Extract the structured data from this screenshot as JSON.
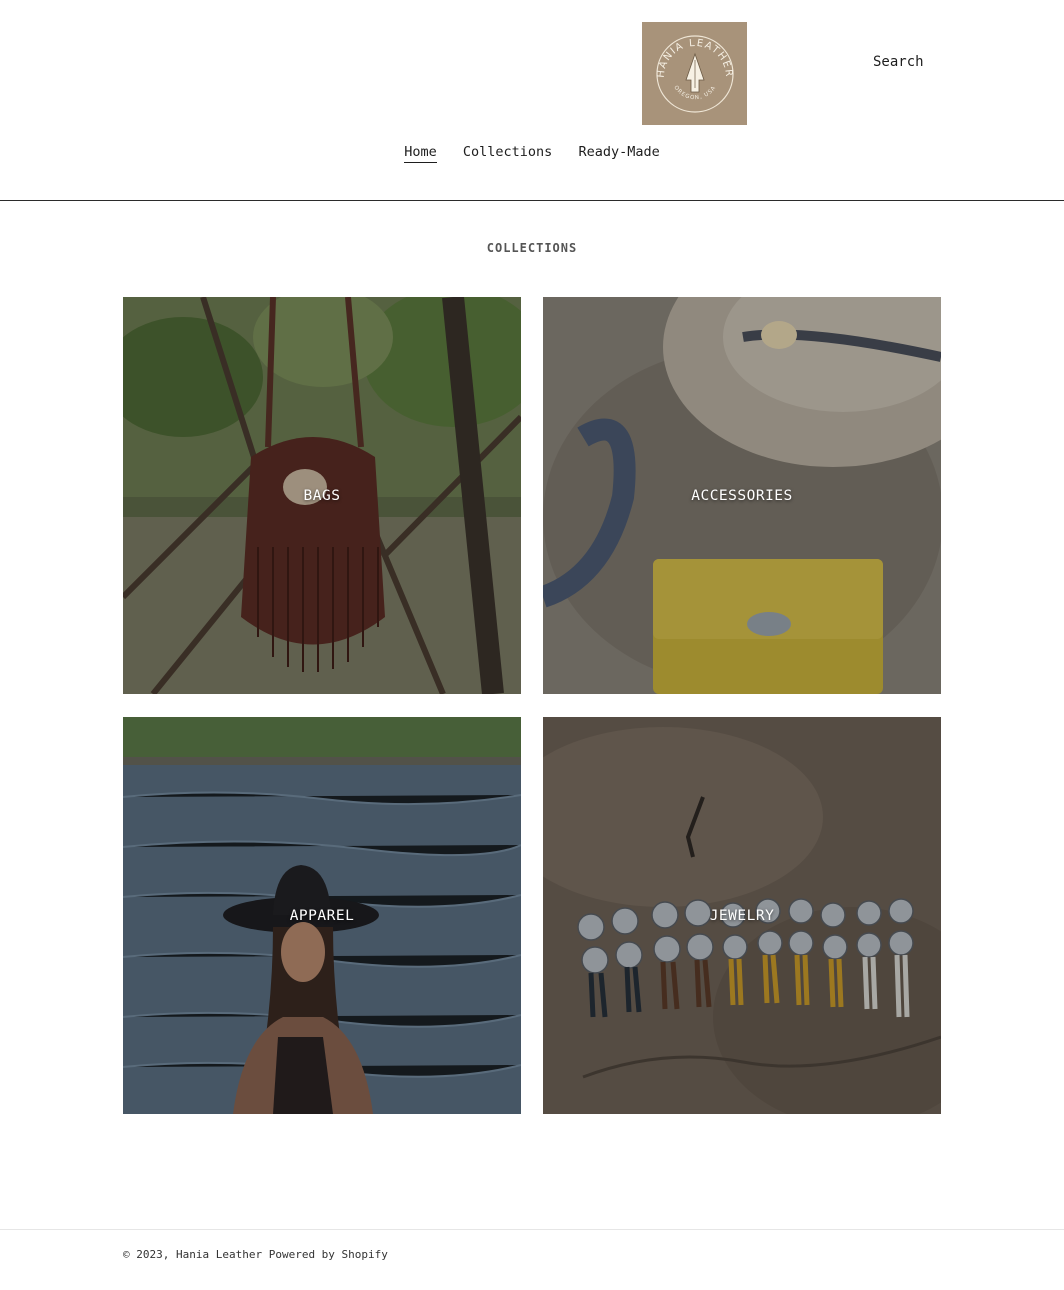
{
  "brand": {
    "name": "Hania Leather",
    "logo_text_top": "HANIA LEATHER",
    "logo_text_bottom": "OREGON, USA",
    "logo_bg": "#a8937a"
  },
  "header": {
    "search_label": "Search",
    "nav": [
      {
        "label": "Home",
        "active": true
      },
      {
        "label": "Collections",
        "active": false
      },
      {
        "label": "Ready-Made",
        "active": false
      }
    ]
  },
  "main": {
    "section_title": "COLLECTIONS",
    "collections": [
      {
        "label": "BAGS",
        "image": "fringe-leather-bag-in-tree"
      },
      {
        "label": "ACCESSORIES",
        "image": "hat-horseshoe-yellow-pouch"
      },
      {
        "label": "APPAREL",
        "image": "woman-in-black-hat-in-river"
      },
      {
        "label": "JEWELRY",
        "image": "concho-earrings-on-rock"
      }
    ]
  },
  "footer": {
    "copyright": "© 2023, Hania Leather",
    "powered_by": "Powered by Shopify"
  }
}
